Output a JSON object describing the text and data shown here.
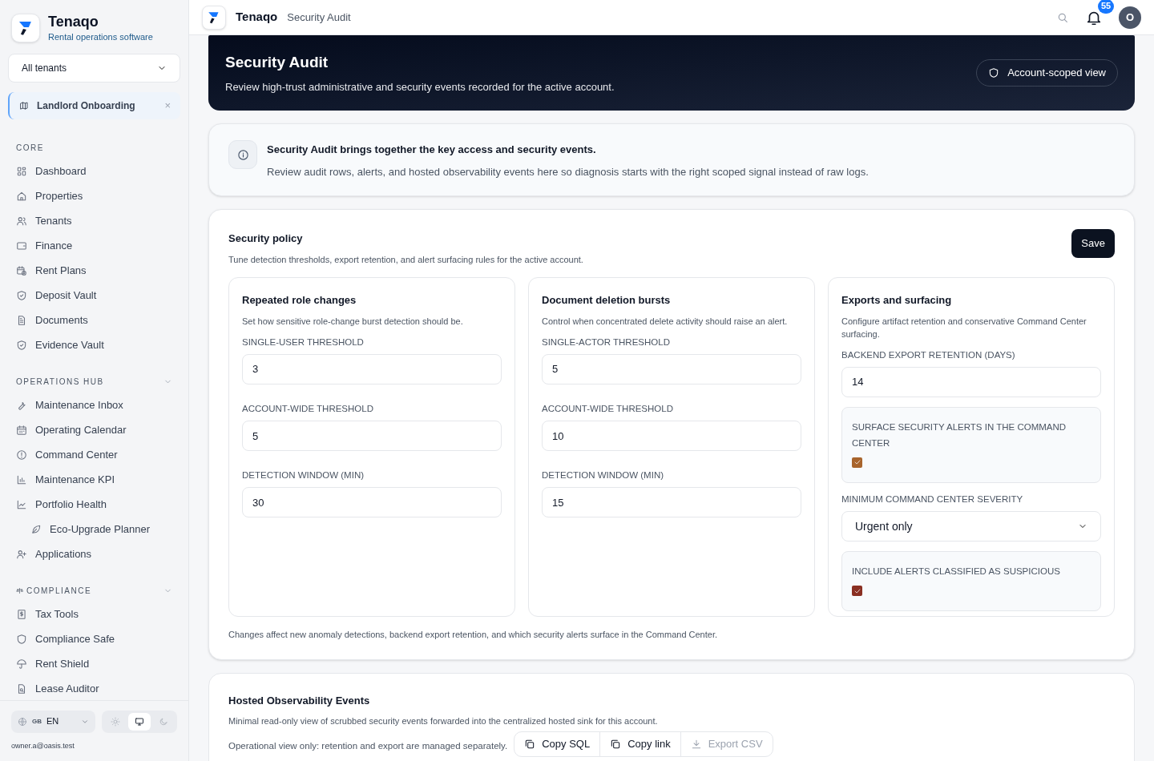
{
  "brand": {
    "name": "Tenaqo",
    "tagline": "Rental operations software"
  },
  "sidebar": {
    "tenant_select": {
      "value": "All tenants"
    },
    "pinned": {
      "label": "Landlord Onboarding",
      "close": "×"
    },
    "sections": [
      {
        "title": "CORE",
        "collapsible": false,
        "items": [
          {
            "label": "Dashboard"
          },
          {
            "label": "Properties"
          },
          {
            "label": "Tenants"
          },
          {
            "label": "Finance"
          },
          {
            "label": "Rent Plans"
          },
          {
            "label": "Deposit Vault"
          },
          {
            "label": "Documents"
          },
          {
            "label": "Evidence Vault"
          }
        ]
      },
      {
        "title": "OPERATIONS HUB",
        "collapsible": true,
        "items": [
          {
            "label": "Maintenance Inbox"
          },
          {
            "label": "Operating Calendar"
          },
          {
            "label": "Command Center"
          },
          {
            "label": "Maintenance KPI"
          },
          {
            "label": "Portfolio Health",
            "children": [
              {
                "label": "Eco-Upgrade Planner"
              }
            ]
          },
          {
            "label": "Applications"
          }
        ]
      },
      {
        "title": "COMPLIANCE",
        "collapsible": true,
        "items": [
          {
            "label": "Tax Tools"
          },
          {
            "label": "Compliance Safe"
          },
          {
            "label": "Rent Shield"
          },
          {
            "label": "Lease Auditor"
          }
        ]
      }
    ],
    "language": {
      "flag": "GB",
      "code": "EN"
    },
    "theme_modes": [
      {
        "kind": "light",
        "selected": false
      },
      {
        "kind": "system",
        "selected": true
      },
      {
        "kind": "dark",
        "selected": false
      }
    ],
    "user_email": "owner.a@oasis.test"
  },
  "topbar": {
    "brand": "Tenaqo",
    "page": "Security Audit",
    "notifications": "55",
    "avatar": "O"
  },
  "hero": {
    "title": "Security Audit",
    "subtitle": "Review high-trust administrative and security events recorded for the active account.",
    "badge": "Account-scoped view"
  },
  "info": {
    "title": "Security Audit brings together the key access and security events.",
    "text": "Review audit rows, alerts, and hosted observability events here so diagnosis starts with the right scoped signal instead of raw logs."
  },
  "policy": {
    "title": "Security policy",
    "description": "Tune detection thresholds, export retention, and alert surfacing rules for the active account.",
    "save": "Save",
    "columns": [
      {
        "title": "Repeated role changes",
        "description": "Set how sensitive role-change burst detection should be.",
        "fields": [
          {
            "kind": "number",
            "label": "SINGLE-USER THRESHOLD",
            "value": "3"
          },
          {
            "kind": "number",
            "label": "ACCOUNT-WIDE THRESHOLD",
            "value": "5"
          },
          {
            "kind": "number",
            "label": "DETECTION WINDOW (MIN)",
            "value": "30"
          }
        ]
      },
      {
        "title": "Document deletion bursts",
        "description": "Control when concentrated delete activity should raise an alert.",
        "fields": [
          {
            "kind": "number",
            "label": "SINGLE-ACTOR THRESHOLD",
            "value": "5"
          },
          {
            "kind": "number",
            "label": "ACCOUNT-WIDE THRESHOLD",
            "value": "10"
          },
          {
            "kind": "number",
            "label": "DETECTION WINDOW (MIN)",
            "value": "15"
          }
        ]
      },
      {
        "title": "Exports and surfacing",
        "description": "Configure artifact retention and conservative Command Center surfacing.",
        "fields": [
          {
            "kind": "number",
            "label": "BACKEND EXPORT RETENTION (DAYS)",
            "value": "14"
          },
          {
            "kind": "checkbox",
            "label": "SURFACE SECURITY ALERTS IN THE COMMAND CENTER",
            "checked": true,
            "color": "#a8642c"
          },
          {
            "kind": "select",
            "label": "MINIMUM COMMAND CENTER SEVERITY",
            "value": "Urgent only"
          },
          {
            "kind": "checkbox",
            "label": "INCLUDE ALERTS CLASSIFIED AS SUSPICIOUS",
            "checked": true,
            "color": "#8a2f22"
          }
        ]
      }
    ],
    "footnote": "Changes affect new anomaly detections, backend export retention, and which security alerts surface in the Command Center."
  },
  "observability": {
    "title": "Hosted Observability Events",
    "description": "Minimal read-only view of scrubbed security events forwarded into the centralized hosted sink for this account.",
    "note": "Operational view only: retention and export are managed separately.",
    "actions": [
      {
        "kind": "copy",
        "label": "Copy SQL",
        "disabled": false
      },
      {
        "kind": "copy",
        "label": "Copy link",
        "disabled": false
      },
      {
        "kind": "download",
        "label": "Export CSV",
        "disabled": true
      }
    ]
  }
}
